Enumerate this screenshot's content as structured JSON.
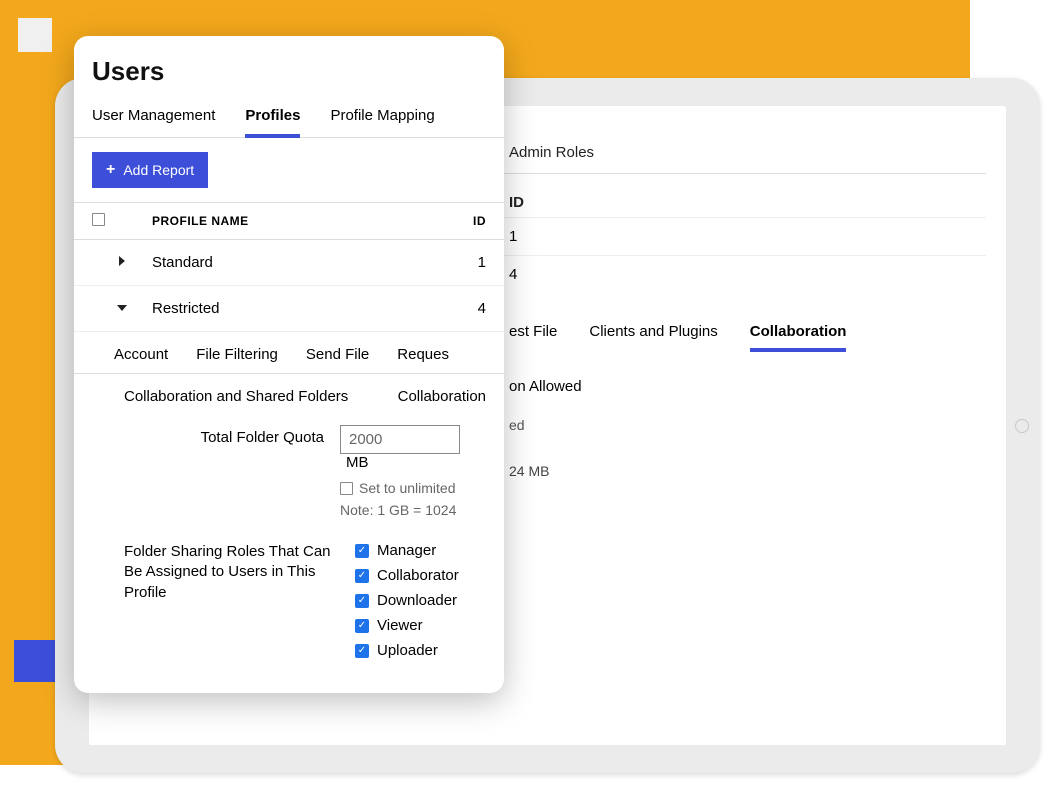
{
  "title": "Users",
  "navTabs": [
    "User Management",
    "Profiles",
    "Profile Mapping"
  ],
  "navActive": "Profiles",
  "addButton": "Add Report",
  "table": {
    "headers": {
      "name": "PROFILE NAME",
      "id": "ID"
    },
    "rows": [
      {
        "name": "Standard",
        "id": "1",
        "expanded": false
      },
      {
        "name": "Restricted",
        "id": "4",
        "expanded": true
      }
    ]
  },
  "subTabs": [
    "Account",
    "File Filtering",
    "Send File",
    "Reques"
  ],
  "collabLabels": {
    "shared": "Collaboration and Shared Folders",
    "collab": "Collaboration"
  },
  "quota": {
    "label": "Total Folder Quota",
    "value": "2000",
    "unit": "MB",
    "unlimited": "Set to unlimited",
    "note": "Note: 1 GB = 1024"
  },
  "roles": {
    "label": "Folder Sharing Roles That Can Be Assigned to Users in This Profile",
    "items": [
      "Manager",
      "Collaborator",
      "Downloader",
      "Viewer",
      "Uploader"
    ]
  },
  "back": {
    "adminRoles": "Admin Roles",
    "idHeader": "ID",
    "ids": [
      "1",
      "4"
    ],
    "tabs": [
      "est File",
      "Clients and Plugins",
      "Collaboration"
    ],
    "tabActive": "Collaboration",
    "allowed": "on Allowed",
    "unlimitedSuffix": "ed",
    "noteSuffix": "24 MB"
  }
}
